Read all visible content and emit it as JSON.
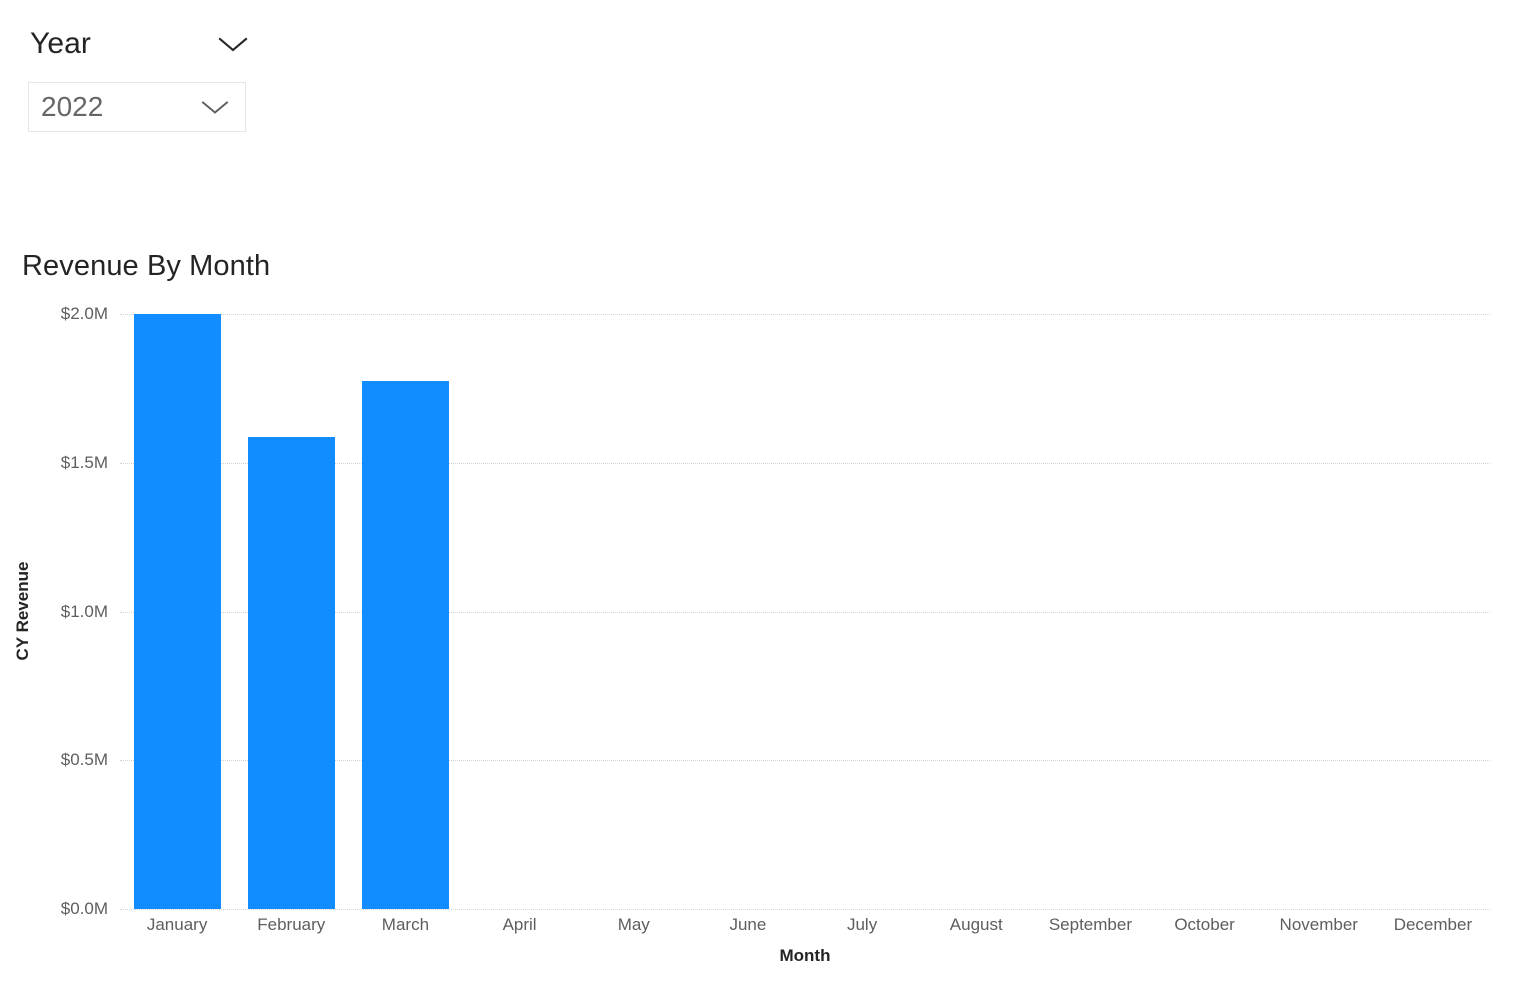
{
  "slicer": {
    "name": "year-slicer",
    "title": "Year",
    "selected_value": "2022",
    "expand_icon": "chevron-down-icon",
    "dropdown_icon": "chevron-down-icon"
  },
  "visual": {
    "title": "Revenue By Month"
  },
  "chart_data": {
    "type": "bar",
    "title": "Revenue By Month",
    "xlabel": "Month",
    "ylabel": "CY Revenue",
    "categories": [
      "January",
      "February",
      "March",
      "April",
      "May",
      "June",
      "July",
      "August",
      "September",
      "October",
      "November",
      "December"
    ],
    "values": [
      2.0,
      1.586,
      1.775,
      null,
      null,
      null,
      null,
      null,
      null,
      null,
      null,
      null
    ],
    "value_unit": "millions of dollars",
    "ylim": [
      0.0,
      2.0
    ],
    "yticks": [
      0.0,
      0.5,
      1.0,
      1.5,
      2.0
    ],
    "ytick_labels": [
      "$0.0M",
      "$0.5M",
      "$1.0M",
      "$1.5M",
      "$2.0M"
    ],
    "grid": true,
    "grid_style": "dotted",
    "legend": false,
    "series_color": "#118DFF",
    "series": [
      {
        "name": "CY Revenue",
        "color": "#118DFF",
        "values": [
          2.0,
          1.586,
          1.775,
          null,
          null,
          null,
          null,
          null,
          null,
          null,
          null,
          null
        ]
      }
    ]
  },
  "colors": {
    "bar": "#118DFF",
    "text_primary": "#252423",
    "text_secondary": "#605e5c",
    "gridline": "#d4d4d4",
    "border": "#e6e6e6",
    "background": "#ffffff"
  }
}
